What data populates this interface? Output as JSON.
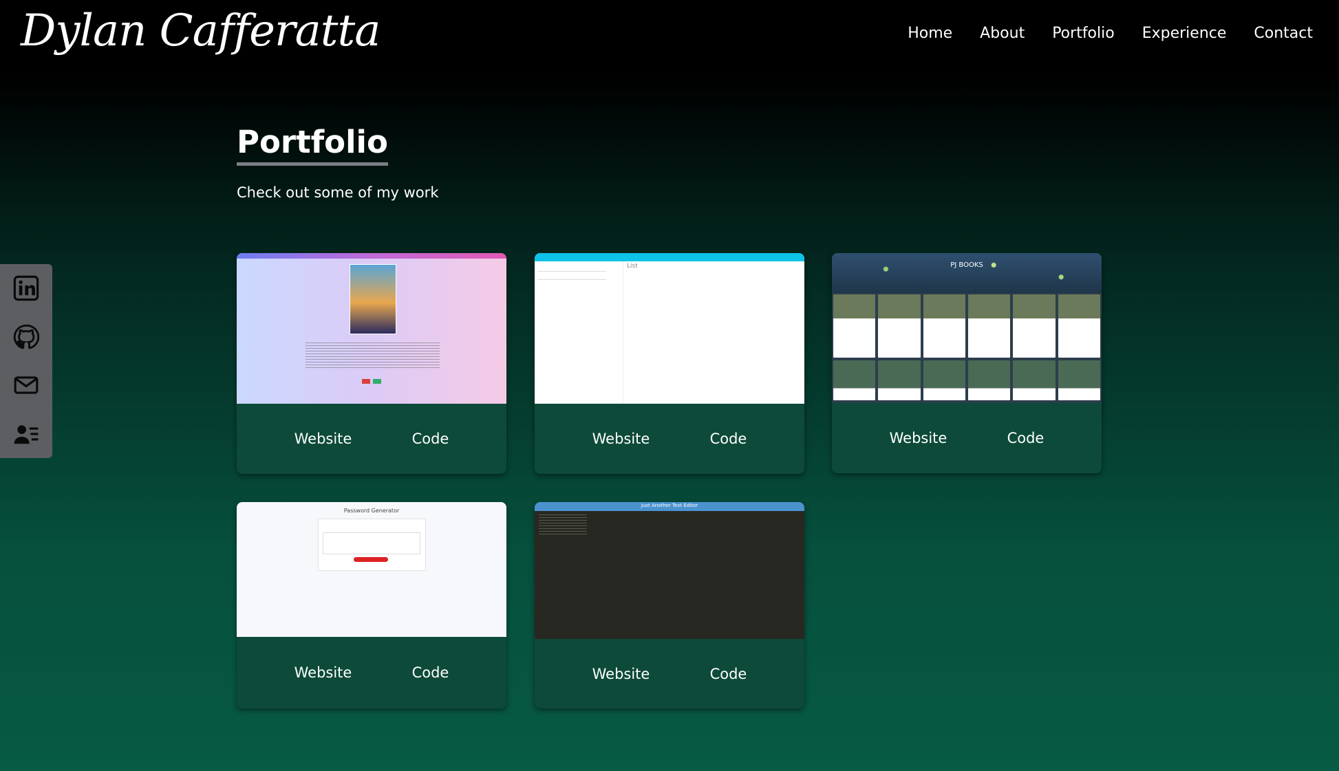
{
  "header": {
    "logo": "Dylan Cafferatta",
    "nav": [
      "Home",
      "About",
      "Portfolio",
      "Experience",
      "Contact"
    ]
  },
  "main": {
    "title": "Portfolio",
    "subtitle": "Check out some of my work"
  },
  "social": {
    "icons": [
      "linkedin-icon",
      "github-icon",
      "mail-icon",
      "contact-card-icon"
    ]
  },
  "projects": [
    {
      "website_label": "Website",
      "code_label": "Code",
      "thumb_title": ""
    },
    {
      "website_label": "Website",
      "code_label": "Code",
      "thumb_title": "List"
    },
    {
      "website_label": "Website",
      "code_label": "Code",
      "thumb_title": "PJ BOOKS"
    },
    {
      "website_label": "Website",
      "code_label": "Code",
      "thumb_title": "Password Generator"
    },
    {
      "website_label": "Website",
      "code_label": "Code",
      "thumb_title": "Just Another Text Editor"
    }
  ],
  "colors": {
    "card_bg": "#0d4a3a",
    "sidebar_bg": "#5c5e62",
    "title_underline": "#7a7e85"
  }
}
